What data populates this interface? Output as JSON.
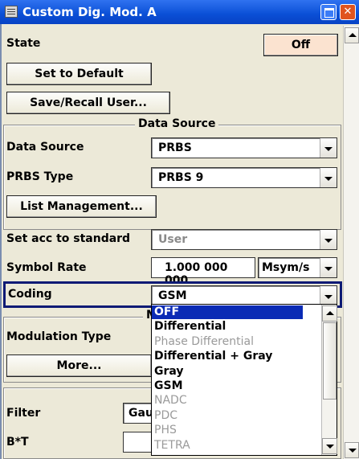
{
  "window": {
    "title": "Custom Dig. Mod. A"
  },
  "state": {
    "label": "State",
    "button": "Off"
  },
  "buttons": {
    "set_default": "Set to Default",
    "save_recall": "Save/Recall User...",
    "list_mgmt": "List Management...",
    "more": "More..."
  },
  "data_source_group": {
    "title": "Data Source"
  },
  "data_source": {
    "label": "Data Source",
    "value": "PRBS"
  },
  "prbs_type": {
    "label": "PRBS Type",
    "value": "PRBS 9"
  },
  "standard": {
    "label": "Set acc to standard",
    "value": "User"
  },
  "symbol_rate": {
    "label": "Symbol Rate",
    "value": "1.000 000 000",
    "unit": "Msym/s"
  },
  "coding": {
    "label": "Coding",
    "value": "GSM"
  },
  "modulation_group": {
    "title_fragment": "M"
  },
  "modulation_type": {
    "label": "Modulation Type"
  },
  "filter": {
    "label": "Filter",
    "value_fragment": "Gau"
  },
  "bt": {
    "label": "B*T"
  },
  "coding_options": [
    {
      "label": "OFF",
      "selected": true,
      "enabled": true
    },
    {
      "label": "Differential",
      "selected": false,
      "enabled": true
    },
    {
      "label": "Phase Differential",
      "selected": false,
      "enabled": false
    },
    {
      "label": "Differential + Gray",
      "selected": false,
      "enabled": true
    },
    {
      "label": "Gray",
      "selected": false,
      "enabled": true
    },
    {
      "label": "GSM",
      "selected": false,
      "enabled": true
    },
    {
      "label": "NADC",
      "selected": false,
      "enabled": false
    },
    {
      "label": "PDC",
      "selected": false,
      "enabled": false
    },
    {
      "label": "PHS",
      "selected": false,
      "enabled": false
    },
    {
      "label": "TETRA",
      "selected": false,
      "enabled": false
    }
  ],
  "colors": {
    "titlebar": "#0a4fd6",
    "selection": "#0a2bb5",
    "focus_border": "#0d1a75",
    "state_off_bg": "#fbe3d0"
  }
}
